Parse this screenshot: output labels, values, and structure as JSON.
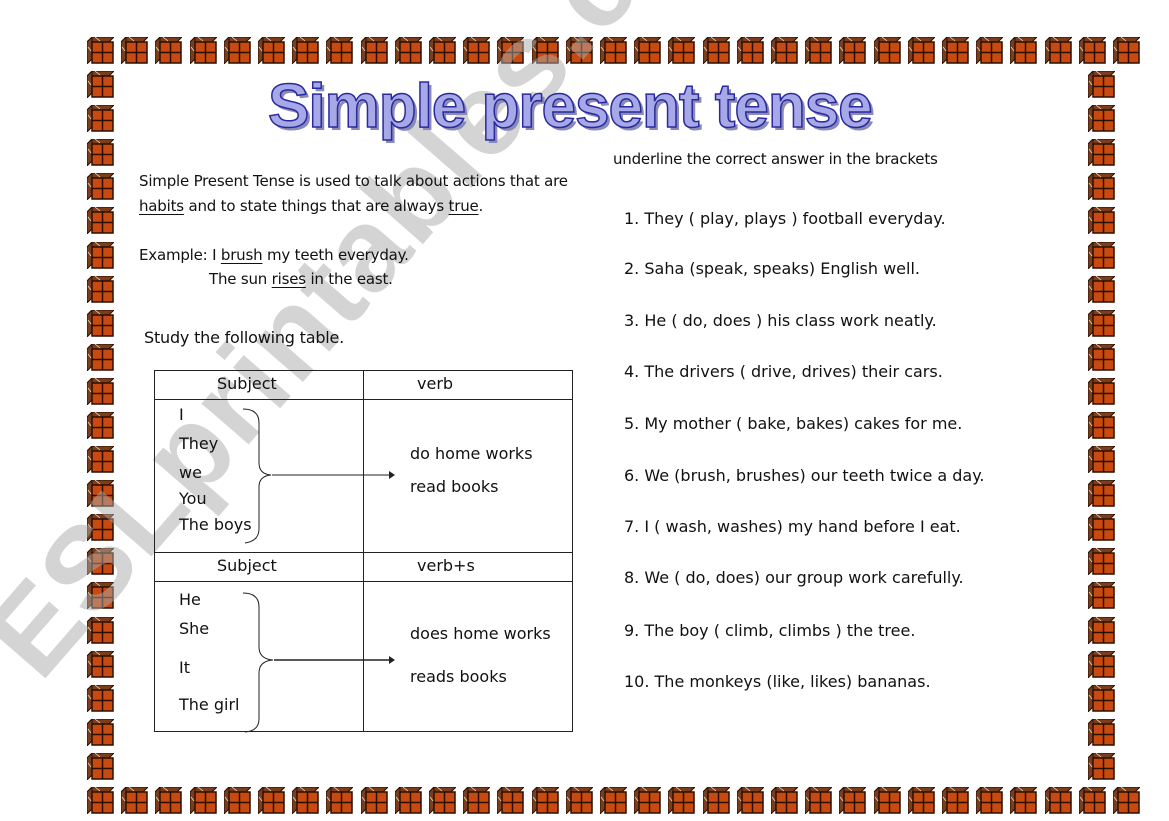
{
  "title": "Simple present tense",
  "intro": {
    "line1_bold": "Simple Present  Tense",
    "line1_rest": " is used to talk about actions that are",
    "line2_u1": "habits",
    "line2_mid": " and to state things that are always ",
    "line2_u2": "true",
    "line2_end": "."
  },
  "example": {
    "label": "Example: I ",
    "verb1": "brush",
    "rest1": " my teeth everyday.",
    "pre2": "The sun ",
    "verb2": "rises",
    "rest2": " in the east."
  },
  "study_label": "Study the following table.",
  "table": {
    "section1": {
      "subject_header": "Subject",
      "verb_header": "verb",
      "subjects": [
        "I",
        "They",
        "we",
        "You",
        "The boys"
      ],
      "verbs": [
        "do home works",
        "read books"
      ]
    },
    "section2": {
      "subject_header": "Subject",
      "verb_header": "verb+s",
      "subjects": [
        "He",
        "She",
        "It",
        "The girl"
      ],
      "verbs": [
        "does home works",
        "reads books"
      ]
    }
  },
  "exercise": {
    "instruction": "underline the correct answer in the brackets",
    "questions": [
      "1. They ( play, plays ) football everyday.",
      "2. Saha (speak, speaks) English well.",
      "3. He ( do, does ) his class work neatly.",
      "4. The drivers ( drive, drives) their cars.",
      "5. My mother ( bake, bakes) cakes for me.",
      "6. We (brush, brushes) our teeth twice a day.",
      "7. I ( wash, washes) my hand before I eat.",
      "8. We ( do, does) our group work carefully.",
      "9. The boy ( climb, climbs ) the tree.",
      "10. The monkeys (like, likes) bananas."
    ]
  },
  "watermark": "ESLprintables.com",
  "colors": {
    "cube_front": "#c84a10",
    "cube_side": "#7a3e1c",
    "title_fill": "#a6a8e8",
    "title_stroke": "#2a2a9c"
  }
}
